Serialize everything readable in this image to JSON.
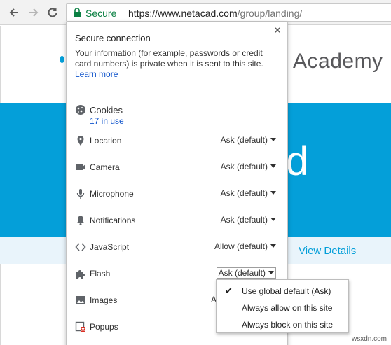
{
  "toolbar": {
    "secure_label": "Secure",
    "url_domain": "https://www.netacad.com",
    "url_path": "/group/landing/"
  },
  "page": {
    "logo_text": "Academy",
    "hero_text": "d",
    "view_details": "View Details"
  },
  "bubble": {
    "title": "Secure connection",
    "description": "Your information (for example, passwords or credit card numbers) is private when it is sent to this site.",
    "learn_more": "Learn more",
    "close_glyph": "×",
    "cookies": {
      "label": "Cookies",
      "sub": "17 in use"
    },
    "permissions": [
      {
        "label": "Location",
        "value": "Ask (default)",
        "icon": "location-pin-icon"
      },
      {
        "label": "Camera",
        "value": "Ask (default)",
        "icon": "camera-icon"
      },
      {
        "label": "Microphone",
        "value": "Ask (default)",
        "icon": "microphone-icon"
      },
      {
        "label": "Notifications",
        "value": "Ask (default)",
        "icon": "bell-icon"
      },
      {
        "label": "JavaScript",
        "value": "Allow (default)",
        "icon": "code-brackets-icon"
      },
      {
        "label": "Flash",
        "value": "Ask (default)",
        "icon": "puzzle-piece-icon"
      },
      {
        "label": "Images",
        "value": "A",
        "icon": "image-icon"
      },
      {
        "label": "Popups",
        "value": "",
        "icon": "popup-blocked-icon"
      }
    ]
  },
  "dropdown": {
    "items": [
      {
        "label": "Use global default (Ask)",
        "checked": true
      },
      {
        "label": "Always allow on this site",
        "checked": false
      },
      {
        "label": "Always block on this site",
        "checked": false
      }
    ],
    "check_glyph": "✔"
  },
  "watermark": "wsxdn.com",
  "colors": {
    "secure_green": "#0b8043",
    "hero_blue": "#049fd9",
    "link_blue": "#1155cc"
  }
}
